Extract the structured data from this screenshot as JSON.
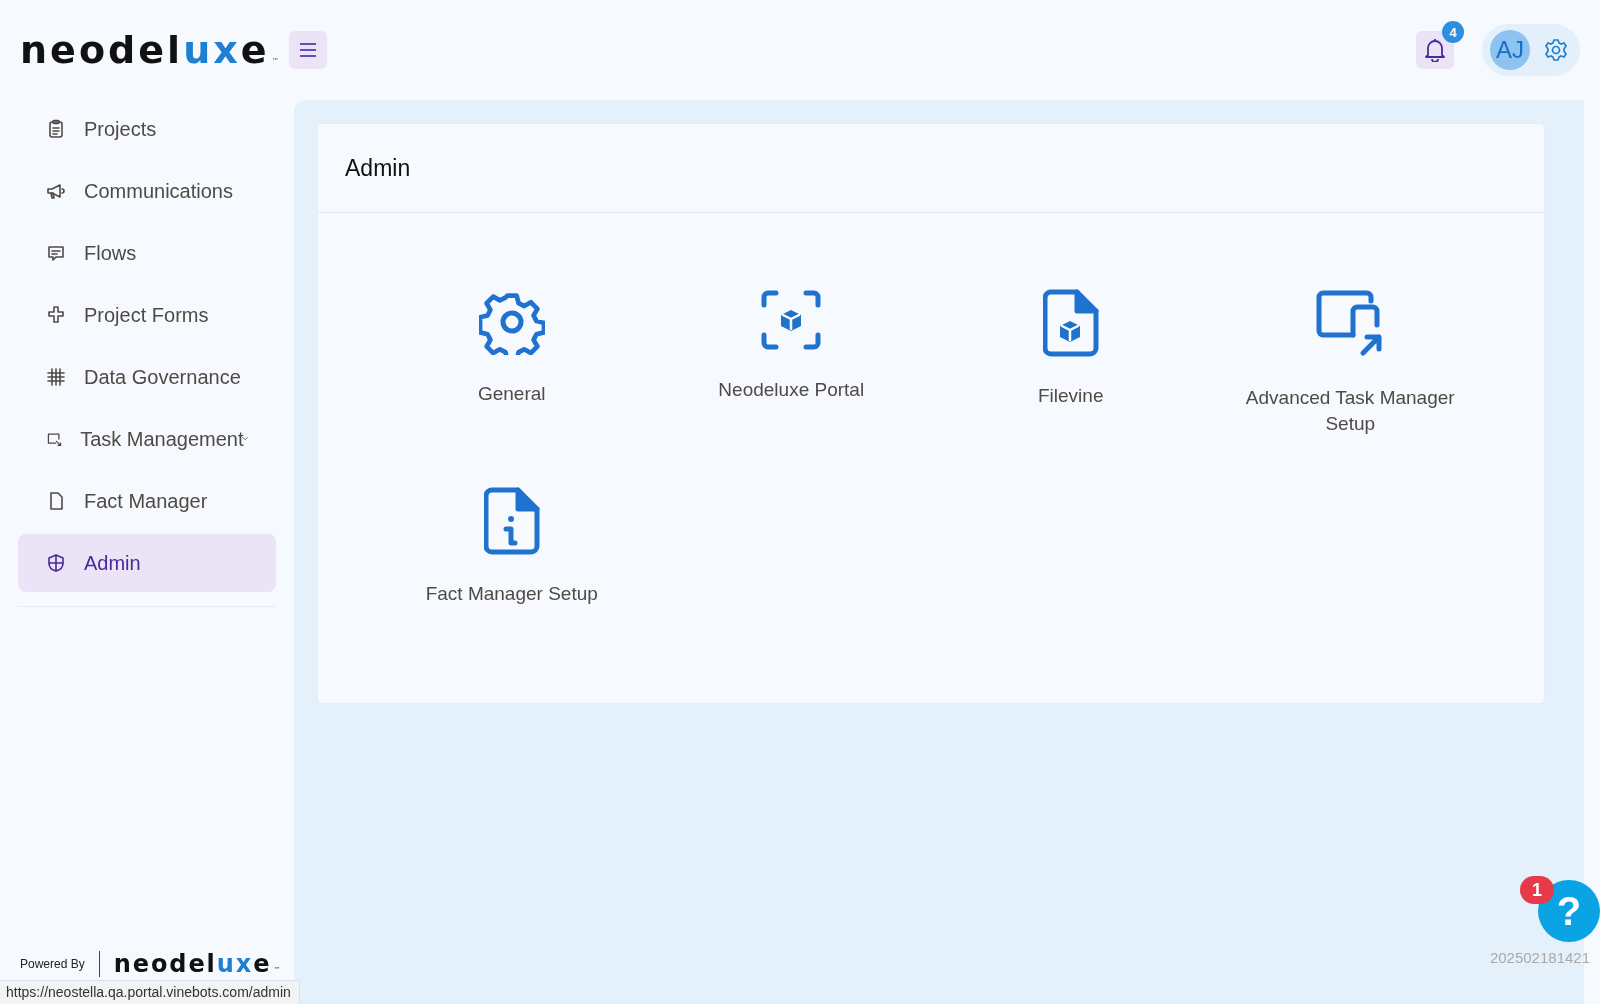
{
  "brand": {
    "parts": [
      {
        "text": "neodel",
        "accent": false
      },
      {
        "text": "ux",
        "accent": true
      },
      {
        "text": "e",
        "accent": false
      }
    ],
    "mark": "™"
  },
  "header": {
    "notifications": {
      "count": "4"
    },
    "avatar": {
      "initials": "AJ"
    }
  },
  "sidebar": {
    "items": [
      {
        "label": "Projects",
        "selected": false,
        "expandable": false
      },
      {
        "label": "Communications",
        "selected": false,
        "expandable": false
      },
      {
        "label": "Flows",
        "selected": false,
        "expandable": false
      },
      {
        "label": "Project Forms",
        "selected": false,
        "expandable": false
      },
      {
        "label": "Data Governance",
        "selected": false,
        "expandable": false
      },
      {
        "label": "Task Management",
        "selected": false,
        "expandable": true
      },
      {
        "label": "Fact Manager",
        "selected": false,
        "expandable": false
      },
      {
        "label": "Admin",
        "selected": true,
        "expandable": false
      }
    ]
  },
  "footer": {
    "powered_by": "Powered By",
    "brand": {
      "parts": [
        {
          "text": "neodel",
          "accent": false
        },
        {
          "text": "ux",
          "accent": true
        },
        {
          "text": "e",
          "accent": false
        }
      ],
      "mark": "™"
    }
  },
  "status_url": "https://neostella.qa.portal.vinebots.com/admin",
  "admin": {
    "title": "Admin",
    "tiles": [
      {
        "label": "General"
      },
      {
        "label": "Neodeluxe Portal"
      },
      {
        "label": "Filevine"
      },
      {
        "label": "Advanced Task Manager Setup"
      },
      {
        "label": "Fact Manager Setup"
      }
    ]
  },
  "help": {
    "badge": "1",
    "glyph": "?"
  },
  "build": "202502181421"
}
